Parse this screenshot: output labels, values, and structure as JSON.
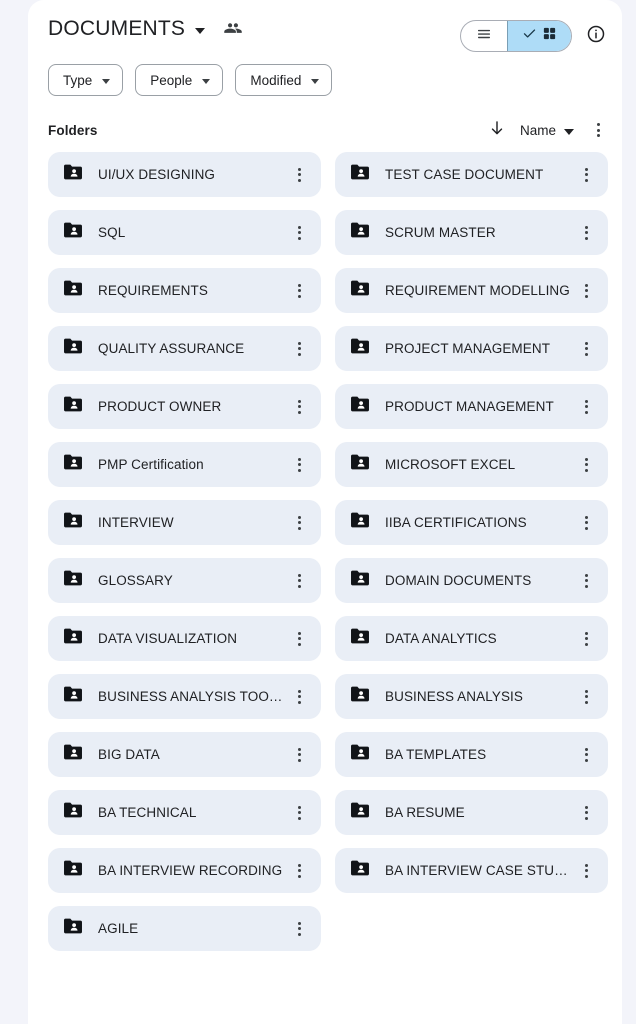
{
  "header": {
    "title": "DOCUMENTS",
    "title_caret_icon": "chevron-down-icon",
    "share_icon": "people-icon",
    "view_toggle": {
      "list_label": "",
      "list_icon": "list-view-icon",
      "grid_icon": "grid-view-icon",
      "grid_check_icon": "check-icon",
      "selected": "grid"
    },
    "info_icon": "info-circle-icon"
  },
  "filters": [
    {
      "label": "Type",
      "icon": "chevron-down-icon"
    },
    {
      "label": "People",
      "icon": "chevron-down-icon"
    },
    {
      "label": "Modified",
      "icon": "chevron-down-icon"
    }
  ],
  "section": {
    "title": "Folders",
    "sort_direction_icon": "arrow-down-icon",
    "sort_label": "Name",
    "sort_caret_icon": "chevron-down-icon",
    "options_icon": "more-vert-icon"
  },
  "folders": [
    {
      "name": "UI/UX DESIGNING",
      "icon": "shared-folder-icon",
      "menu_icon": "more-vert-icon"
    },
    {
      "name": "TEST CASE DOCUMENT",
      "icon": "shared-folder-icon",
      "menu_icon": "more-vert-icon"
    },
    {
      "name": "SQL",
      "icon": "shared-folder-icon",
      "menu_icon": "more-vert-icon"
    },
    {
      "name": "SCRUM MASTER",
      "icon": "shared-folder-icon",
      "menu_icon": "more-vert-icon"
    },
    {
      "name": "REQUIREMENTS",
      "icon": "shared-folder-icon",
      "menu_icon": "more-vert-icon"
    },
    {
      "name": "REQUIREMENT MODELLING",
      "icon": "shared-folder-icon",
      "menu_icon": "more-vert-icon"
    },
    {
      "name": "QUALITY ASSURANCE",
      "icon": "shared-folder-icon",
      "menu_icon": "more-vert-icon"
    },
    {
      "name": "PROJECT MANAGEMENT",
      "icon": "shared-folder-icon",
      "menu_icon": "more-vert-icon"
    },
    {
      "name": "PRODUCT OWNER",
      "icon": "shared-folder-icon",
      "menu_icon": "more-vert-icon"
    },
    {
      "name": "PRODUCT MANAGEMENT",
      "icon": "shared-folder-icon",
      "menu_icon": "more-vert-icon"
    },
    {
      "name": "PMP Certification",
      "icon": "shared-folder-icon",
      "menu_icon": "more-vert-icon"
    },
    {
      "name": "MICROSOFT EXCEL",
      "icon": "shared-folder-icon",
      "menu_icon": "more-vert-icon"
    },
    {
      "name": "INTERVIEW",
      "icon": "shared-folder-icon",
      "menu_icon": "more-vert-icon"
    },
    {
      "name": "IIBA CERTIFICATIONS",
      "icon": "shared-folder-icon",
      "menu_icon": "more-vert-icon"
    },
    {
      "name": "GLOSSARY",
      "icon": "shared-folder-icon",
      "menu_icon": "more-vert-icon"
    },
    {
      "name": "DOMAIN DOCUMENTS",
      "icon": "shared-folder-icon",
      "menu_icon": "more-vert-icon"
    },
    {
      "name": "DATA VISUALIZATION",
      "icon": "shared-folder-icon",
      "menu_icon": "more-vert-icon"
    },
    {
      "name": "DATA ANALYTICS",
      "icon": "shared-folder-icon",
      "menu_icon": "more-vert-icon"
    },
    {
      "name": "BUSINESS ANALYSIS TOOLS A…",
      "icon": "shared-folder-icon",
      "menu_icon": "more-vert-icon"
    },
    {
      "name": "BUSINESS ANALYSIS",
      "icon": "shared-folder-icon",
      "menu_icon": "more-vert-icon"
    },
    {
      "name": "BIG DATA",
      "icon": "shared-folder-icon",
      "menu_icon": "more-vert-icon"
    },
    {
      "name": "BA TEMPLATES",
      "icon": "shared-folder-icon",
      "menu_icon": "more-vert-icon"
    },
    {
      "name": "BA TECHNICAL",
      "icon": "shared-folder-icon",
      "menu_icon": "more-vert-icon"
    },
    {
      "name": "BA RESUME",
      "icon": "shared-folder-icon",
      "menu_icon": "more-vert-icon"
    },
    {
      "name": "BA INTERVIEW RECORDING",
      "icon": "shared-folder-icon",
      "menu_icon": "more-vert-icon"
    },
    {
      "name": "BA INTERVIEW CASE STUDIES",
      "icon": "shared-folder-icon",
      "menu_icon": "more-vert-icon"
    },
    {
      "name": "AGILE",
      "icon": "shared-folder-icon",
      "menu_icon": "more-vert-icon"
    }
  ],
  "colors": {
    "page_background": "#f3f4fa",
    "panel_background": "#ffffff",
    "card_background": "#e9eef6",
    "text": "#202124",
    "accent_selected": "#aedcf7"
  }
}
